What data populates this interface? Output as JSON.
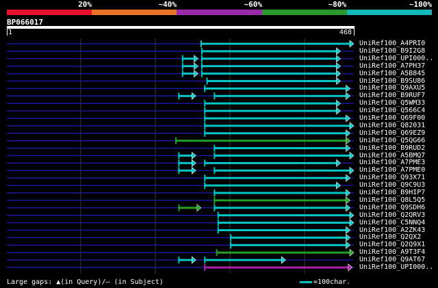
{
  "scale": {
    "segments": [
      "#e8102a",
      "#e8742a",
      "#9a2aa8",
      "#2a9a2a",
      "#14b8b8"
    ],
    "labels": [
      "20%",
      "~40%",
      "~60%",
      "~80%",
      "~100%"
    ]
  },
  "query": {
    "name": "BP066017",
    "start": "1",
    "end": "468"
  },
  "colors": {
    "cyan": "#00c8c8",
    "green": "#22a022",
    "magenta": "#b020b0",
    "dashed": "#1a1aa0",
    "grid": "#3a3a3a"
  },
  "hits": [
    {
      "label": "UniRef100_A4PRI0",
      "segs": [
        {
          "s": 262,
          "e": 468,
          "c": "cyan",
          "arrow": true
        }
      ]
    },
    {
      "label": "UniRef100_B9I2G8",
      "segs": [
        {
          "s": 263,
          "e": 450,
          "c": "cyan",
          "arrow": true
        }
      ]
    },
    {
      "label": "UniRef100_UPI000..",
      "segs": [
        {
          "s": 237,
          "e": 258,
          "c": "cyan",
          "arrow": true
        },
        {
          "s": 263,
          "e": 450,
          "c": "cyan",
          "arrow": true
        }
      ]
    },
    {
      "label": "UniRef100_A7PH37",
      "segs": [
        {
          "s": 237,
          "e": 258,
          "c": "cyan",
          "arrow": true
        },
        {
          "s": 263,
          "e": 450,
          "c": "cyan",
          "arrow": true
        }
      ]
    },
    {
      "label": "UniRef100_A5B845",
      "segs": [
        {
          "s": 237,
          "e": 258,
          "c": "cyan",
          "arrow": true
        },
        {
          "s": 263,
          "e": 450,
          "c": "cyan",
          "arrow": true
        }
      ]
    },
    {
      "label": "UniRef100_B9SU86",
      "segs": [
        {
          "s": 270,
          "e": 450,
          "c": "cyan",
          "arrow": true
        }
      ]
    },
    {
      "label": "UniRef100_Q9AXU5",
      "segs": [
        {
          "s": 267,
          "e": 463,
          "c": "cyan",
          "arrow": true
        }
      ]
    },
    {
      "label": "UniRef100_B9RUF7",
      "segs": [
        {
          "s": 232,
          "e": 255,
          "c": "cyan",
          "arrow": true
        },
        {
          "s": 280,
          "e": 463,
          "c": "cyan",
          "arrow": true
        }
      ]
    },
    {
      "label": "UniRef100_Q5WM33",
      "segs": [
        {
          "s": 267,
          "e": 450,
          "c": "cyan",
          "arrow": true
        }
      ]
    },
    {
      "label": "UniRef100_Q566C4",
      "segs": [
        {
          "s": 267,
          "e": 450,
          "c": "cyan",
          "arrow": true
        }
      ]
    },
    {
      "label": "UniRef100_Q69F00",
      "segs": [
        {
          "s": 267,
          "e": 463,
          "c": "cyan",
          "arrow": true
        }
      ]
    },
    {
      "label": "UniRef100_Q82031",
      "segs": [
        {
          "s": 267,
          "e": 468,
          "c": "cyan",
          "arrow": true
        }
      ]
    },
    {
      "label": "UniRef100_Q69EZ9",
      "segs": [
        {
          "s": 267,
          "e": 463,
          "c": "cyan",
          "arrow": true
        }
      ]
    },
    {
      "label": "UniRef100_Q5QG66",
      "segs": [
        {
          "s": 228,
          "e": 463,
          "c": "green",
          "arrow": true
        }
      ]
    },
    {
      "label": "UniRef100_B9RUD2",
      "segs": [
        {
          "s": 280,
          "e": 463,
          "c": "cyan",
          "arrow": true
        }
      ]
    },
    {
      "label": "UniRef100_A5BMQ7",
      "segs": [
        {
          "s": 232,
          "e": 255,
          "c": "cyan",
          "arrow": true
        },
        {
          "s": 280,
          "e": 468,
          "c": "cyan",
          "arrow": true
        }
      ]
    },
    {
      "label": "UniRef100_A7PME3",
      "segs": [
        {
          "s": 232,
          "e": 255,
          "c": "cyan",
          "arrow": true
        },
        {
          "s": 267,
          "e": 450,
          "c": "cyan",
          "arrow": true
        }
      ]
    },
    {
      "label": "UniRef100_A7PME0",
      "segs": [
        {
          "s": 232,
          "e": 255,
          "c": "cyan",
          "arrow": true
        },
        {
          "s": 280,
          "e": 468,
          "c": "cyan",
          "arrow": true
        }
      ]
    },
    {
      "label": "UniRef100_Q93X71",
      "segs": [
        {
          "s": 267,
          "e": 463,
          "c": "cyan",
          "arrow": true
        }
      ]
    },
    {
      "label": "UniRef100_Q9C9U3",
      "segs": [
        {
          "s": 267,
          "e": 450,
          "c": "cyan",
          "arrow": true
        }
      ]
    },
    {
      "label": "UniRef100_B9HIP7",
      "segs": [
        {
          "s": 280,
          "e": 463,
          "c": "cyan",
          "arrow": true
        }
      ]
    },
    {
      "label": "UniRef100_Q8L5Q5",
      "segs": [
        {
          "s": 280,
          "e": 463,
          "c": "green",
          "arrow": true
        }
      ]
    },
    {
      "label": "UniRef100_Q9SDH6",
      "segs": [
        {
          "s": 232,
          "e": 262,
          "c": "green",
          "arrow": true
        },
        {
          "s": 280,
          "e": 463,
          "c": "cyan",
          "arrow": true
        }
      ]
    },
    {
      "label": "UniRef100_Q2QRV3",
      "segs": [
        {
          "s": 285,
          "e": 468,
          "c": "cyan",
          "arrow": true
        }
      ]
    },
    {
      "label": "UniRef100_C5NNQ4",
      "segs": [
        {
          "s": 285,
          "e": 468,
          "c": "cyan",
          "arrow": true
        }
      ]
    },
    {
      "label": "UniRef100_A2ZK43",
      "segs": [
        {
          "s": 285,
          "e": 463,
          "c": "cyan",
          "arrow": true
        }
      ]
    },
    {
      "label": "UniRef100_Q2QX2",
      "segs": [
        {
          "s": 302,
          "e": 463,
          "c": "cyan",
          "arrow": true
        }
      ]
    },
    {
      "label": "UniRef100_Q2Q9X1",
      "segs": [
        {
          "s": 302,
          "e": 463,
          "c": "cyan",
          "arrow": true
        }
      ]
    },
    {
      "label": "UniRef100_A9T3F4",
      "segs": [
        {
          "s": 283,
          "e": 468,
          "c": "green",
          "arrow": true
        }
      ]
    },
    {
      "label": "UniRef100_Q9AT67",
      "segs": [
        {
          "s": 232,
          "e": 255,
          "c": "cyan",
          "arrow": true
        },
        {
          "s": 267,
          "e": 376,
          "c": "cyan",
          "arrow": true
        }
      ]
    },
    {
      "label": "UniRef100_UPI000..",
      "segs": [
        {
          "s": 267,
          "e": 466,
          "c": "magenta",
          "arrow": true
        }
      ]
    }
  ],
  "footer": {
    "note": "Large gaps: ▲(in Query)/– (in Subject)",
    "legend_text": "=100char."
  }
}
